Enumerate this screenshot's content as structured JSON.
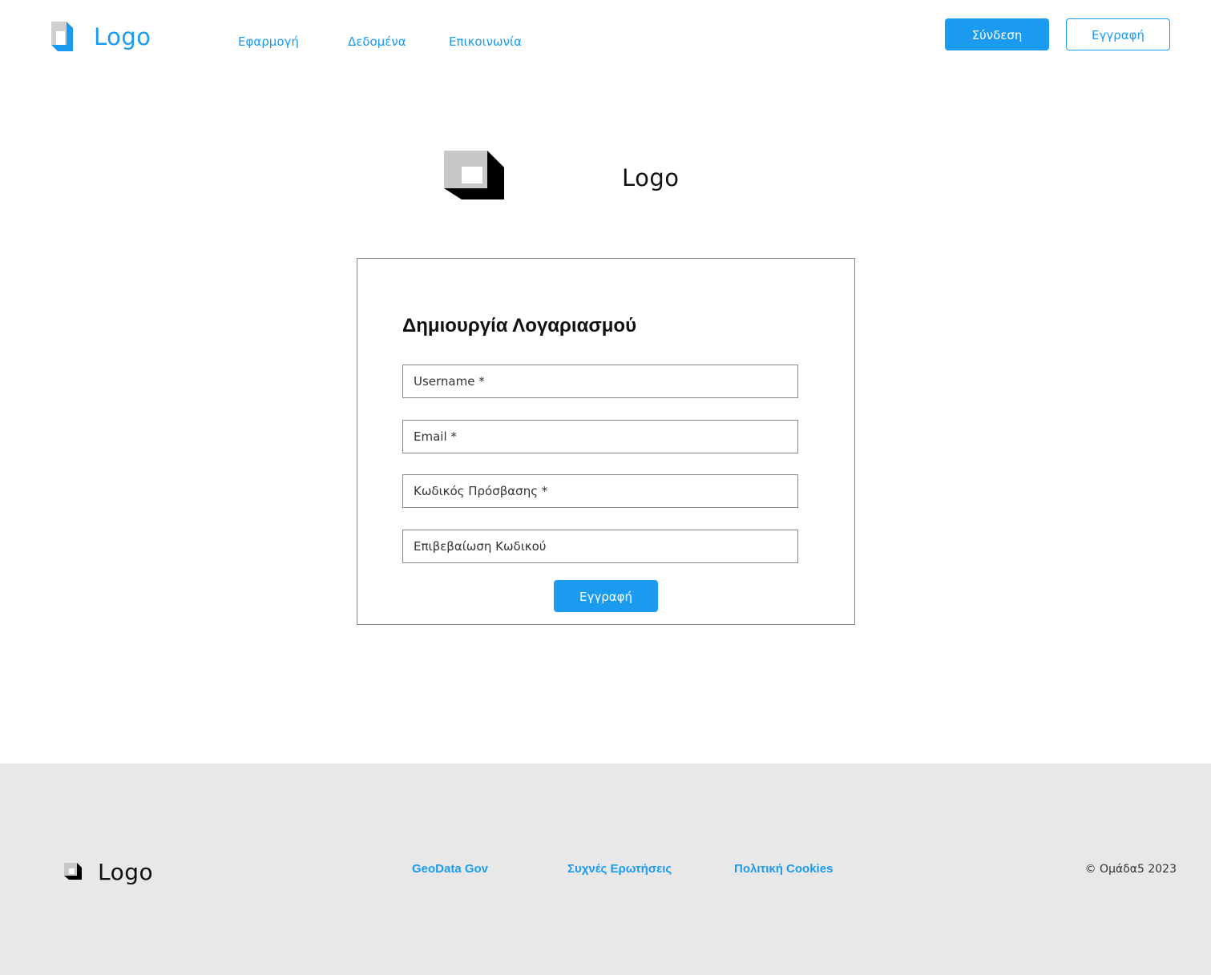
{
  "header": {
    "logo_text": "Logo",
    "nav": [
      {
        "label": "Εφαρμογή"
      },
      {
        "label": "Δεδομένα"
      },
      {
        "label": "Επικοινωνία"
      }
    ],
    "login_label": "Σύνδεση",
    "register_label": "Εγγραφή"
  },
  "center_logo": {
    "text": "Logo"
  },
  "form": {
    "title": "Δημιουργία Λογαριασμού",
    "username_placeholder": "Username *",
    "email_placeholder": "Email *",
    "password_placeholder": "Κωδικός Πρόσβασης *",
    "confirm_placeholder": "Επιβεβαίωση Κωδικού",
    "submit_label": "Εγγραφή"
  },
  "footer": {
    "logo_text": "Logo",
    "links": [
      {
        "label": "GeoData Gov"
      },
      {
        "label": "Συχνές Ερωτήσεις"
      },
      {
        "label": "Πολιτική Cookies"
      }
    ],
    "copyright": "© Ομάδα5 2023"
  },
  "colors": {
    "accent": "#1a9bf0",
    "footer_bg": "#e8e8e8",
    "border": "#8a8a8a"
  }
}
